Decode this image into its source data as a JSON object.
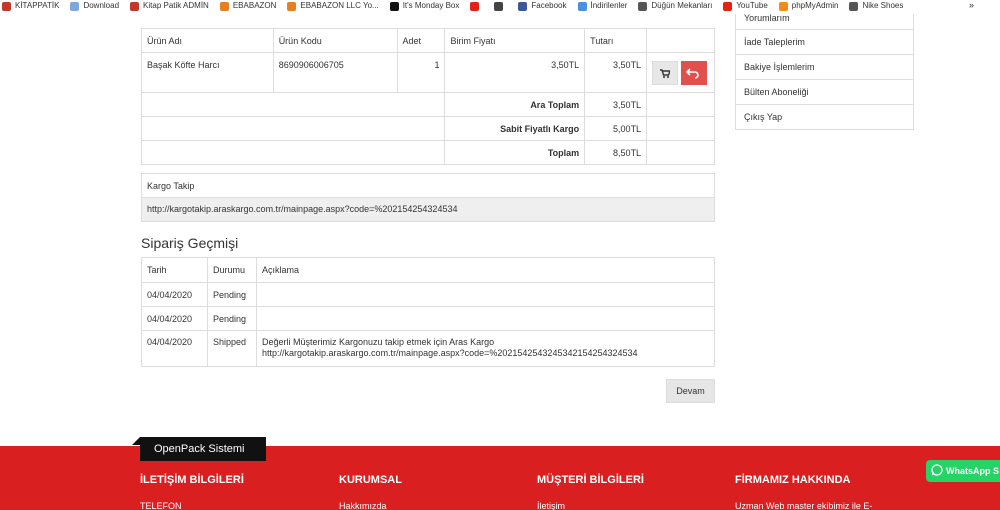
{
  "bookmarks": [
    {
      "label": "KİTAPPATİK",
      "icon": "kitappatik-icon",
      "color": "#c0392b"
    },
    {
      "label": "Download",
      "icon": "download-icon",
      "color": "#7fa7d9"
    },
    {
      "label": "Kitap Patik ADMİN",
      "icon": "kitappatik-admin-icon",
      "color": "#c0392b"
    },
    {
      "label": "EBABAZON",
      "icon": "ebabazon-icon",
      "color": "#e67e22"
    },
    {
      "label": "EBABAZON LLC Yo...",
      "icon": "ebabazon-llc-icon",
      "color": "#e67e22"
    },
    {
      "label": "It's Monday Box",
      "icon": "monday-box-icon",
      "color": "#111111"
    },
    {
      "label": "",
      "icon": "youtube-icon",
      "color": "#e62117"
    },
    {
      "label": "",
      "icon": "chat-icon",
      "color": "#444444"
    },
    {
      "label": "Facebook",
      "icon": "facebook-icon",
      "color": "#3b5998"
    },
    {
      "label": "İndirilenler",
      "icon": "downloads-icon",
      "color": "#4a90e2"
    },
    {
      "label": "Düğün Mekanları",
      "icon": "globe-icon",
      "color": "#555555"
    },
    {
      "label": "YouTube",
      "icon": "youtube-icon",
      "color": "#e62117"
    },
    {
      "label": "phpMyAdmin",
      "icon": "phpmyadmin-icon",
      "color": "#f08c1a"
    },
    {
      "label": "Nike Shoes",
      "icon": "globe-icon",
      "color": "#555555"
    }
  ],
  "bookmarks_more": "»",
  "order": {
    "headers": {
      "name": "Ürün Adı",
      "code": "Ürün Kodu",
      "qty": "Adet",
      "unit_price": "Birim Fiyatı",
      "total": "Tutarı"
    },
    "item": {
      "name": "Başak Köfte Harcı",
      "code": "8690906006705",
      "qty": "1",
      "unit_price": "3,50TL",
      "total": "3,50TL"
    },
    "summary": [
      {
        "label": "Ara Toplam",
        "value": "3,50TL"
      },
      {
        "label": "Sabit Fiyatlı Kargo",
        "value": "5,00TL"
      },
      {
        "label": "Toplam",
        "value": "8,50TL"
      }
    ]
  },
  "tracking": {
    "title": "Kargo Takip",
    "url": "http://kargotakip.araskargo.com.tr/mainpage.aspx?code=%202154254324534"
  },
  "history": {
    "title": "Sipariş Geçmişi",
    "headers": {
      "date": "Tarih",
      "status": "Durumu",
      "desc": "Açıklama"
    },
    "rows": [
      {
        "date": "04/04/2020",
        "status": "Pending",
        "desc1": "",
        "desc2": ""
      },
      {
        "date": "04/04/2020",
        "status": "Pending",
        "desc1": "",
        "desc2": ""
      },
      {
        "date": "04/04/2020",
        "status": "Shipped",
        "desc1": "Değerli Müşterimiz Kargonuzu takip etmek için Aras Kargo",
        "desc2": "http://kargotakip.araskargo.com.tr/mainpage.aspx?code=%20215425432453421542543245​34"
      }
    ]
  },
  "continue_label": "Devam",
  "sidebar": {
    "items": [
      {
        "label": "Yorumlarım"
      },
      {
        "label": "İade Taleplerim"
      },
      {
        "label": "Bakiye İşlemlerim"
      },
      {
        "label": "Bülten Aboneliği"
      },
      {
        "label": "Çıkış Yap"
      }
    ]
  },
  "footer": {
    "badge": "OpenPack Sistemi",
    "columns": [
      {
        "title": "İLETİŞİM BİLGİLERİ",
        "sub": "TELEFON"
      },
      {
        "title": "KURUMSAL",
        "sub": "Hakkımızda"
      },
      {
        "title": "MÜŞTERİ BİLGİLERİ",
        "sub": "İletişim"
      },
      {
        "title": "FİRMAMIZ HAKKINDA",
        "sub": "Uzman Web master ekibimiz ile E-"
      }
    ],
    "whatsapp": "WhatsApp S",
    "bg_color": "#d91f1f"
  }
}
